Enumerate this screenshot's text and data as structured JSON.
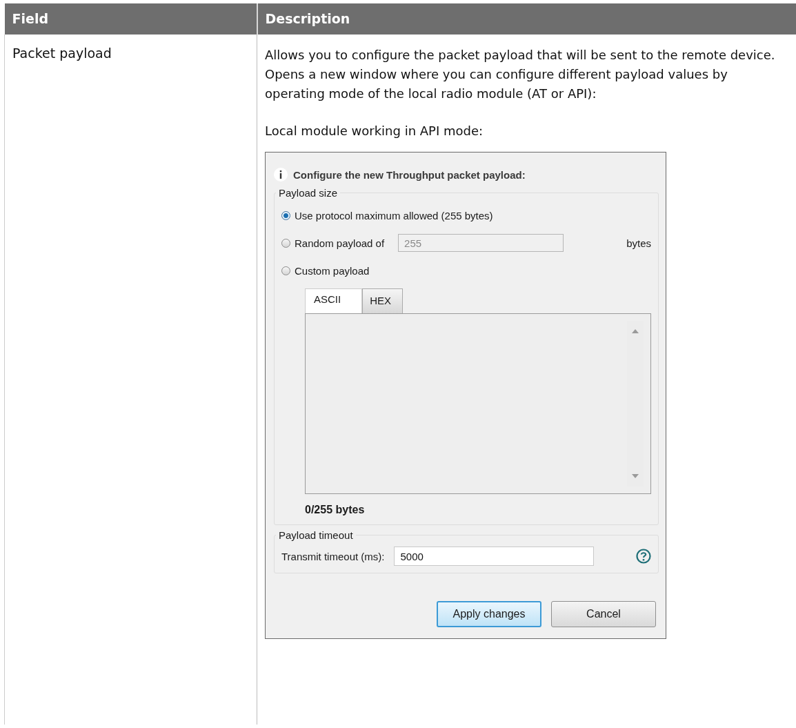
{
  "table": {
    "columns": [
      "Field",
      "Description"
    ],
    "rows": [
      {
        "field": "Packet payload",
        "description": "Allows you to configure the packet payload that will be sent to the remote device. Opens a new window where you can configure different payload values by operating mode of the local radio module (AT or API):",
        "caption": "Local module working in API mode:",
        "dialog": {
          "header": "Configure the new Throughput packet payload:",
          "payload_size": {
            "legend": "Payload size",
            "options": [
              {
                "label": "Use protocol maximum allowed (255 bytes)",
                "selected": true
              },
              {
                "label": "Random payload of",
                "selected": false,
                "kind": "field",
                "value": "255",
                "disabled": true,
                "unit": "bytes"
              },
              {
                "label": "Custom payload",
                "selected": false
              }
            ],
            "tabs": [
              {
                "label": "ASCII",
                "selected": true
              },
              {
                "label": "HEX",
                "selected": false
              }
            ],
            "counter": "0/255 bytes"
          },
          "payload_timeout": {
            "legend": "Payload timeout",
            "label": "Transmit timeout (ms):",
            "value": "5000"
          },
          "buttons": [
            {
              "label": "Apply changes",
              "default": true
            },
            {
              "label": "Cancel",
              "default": false
            }
          ]
        }
      }
    ]
  }
}
